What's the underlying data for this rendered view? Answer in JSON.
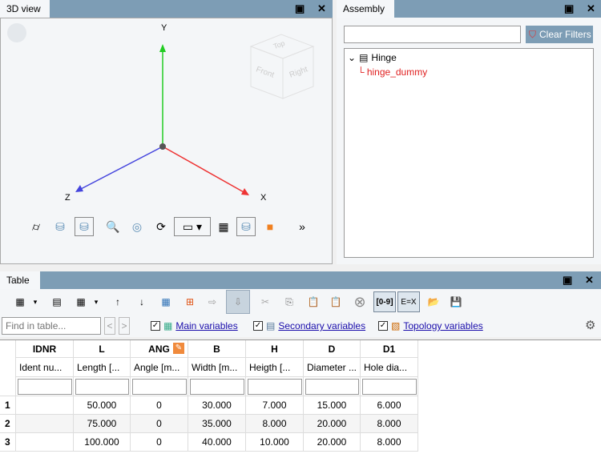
{
  "view3d": {
    "tab": "3D view",
    "axes": {
      "y": "Y",
      "x": "X",
      "z": "Z"
    },
    "cube": {
      "top": "Top",
      "front": "Front",
      "right": "Right"
    },
    "more": "»"
  },
  "assembly": {
    "tab": "Assembly",
    "search_value": "",
    "clear_filters": "Clear Filters",
    "tree": [
      {
        "label": "Hinge"
      },
      {
        "label": "hinge_dummy",
        "color": "#e02020"
      }
    ]
  },
  "table": {
    "tab": "Table",
    "find_placeholder": "Find in table...",
    "prev": "<",
    "next": ">",
    "filters": [
      {
        "label": "Main variables",
        "checked": true
      },
      {
        "label": "Secondary variables",
        "checked": true
      },
      {
        "label": "Topology variables",
        "checked": true
      }
    ],
    "columns": [
      {
        "name": "IDNR",
        "desc": "Ident nu..."
      },
      {
        "name": "L",
        "desc": "Length [..."
      },
      {
        "name": "ANG",
        "desc": "Angle [m..."
      },
      {
        "name": "B",
        "desc": "Width [m..."
      },
      {
        "name": "H",
        "desc": "Heigth [..."
      },
      {
        "name": "D",
        "desc": "Diameter ..."
      },
      {
        "name": "D1",
        "desc": "Hole dia..."
      }
    ],
    "rows": [
      {
        "n": "1",
        "cells": [
          "",
          "50.000",
          "0",
          "30.000",
          "7.000",
          "15.000",
          "6.000"
        ]
      },
      {
        "n": "2",
        "cells": [
          "",
          "75.000",
          "0",
          "35.000",
          "8.000",
          "20.000",
          "8.000"
        ]
      },
      {
        "n": "3",
        "cells": [
          "",
          "100.000",
          "0",
          "40.000",
          "10.000",
          "20.000",
          "8.000"
        ]
      }
    ],
    "toolbar": {
      "range_btn": "[0-9]",
      "formula_btn": "E=X"
    }
  }
}
